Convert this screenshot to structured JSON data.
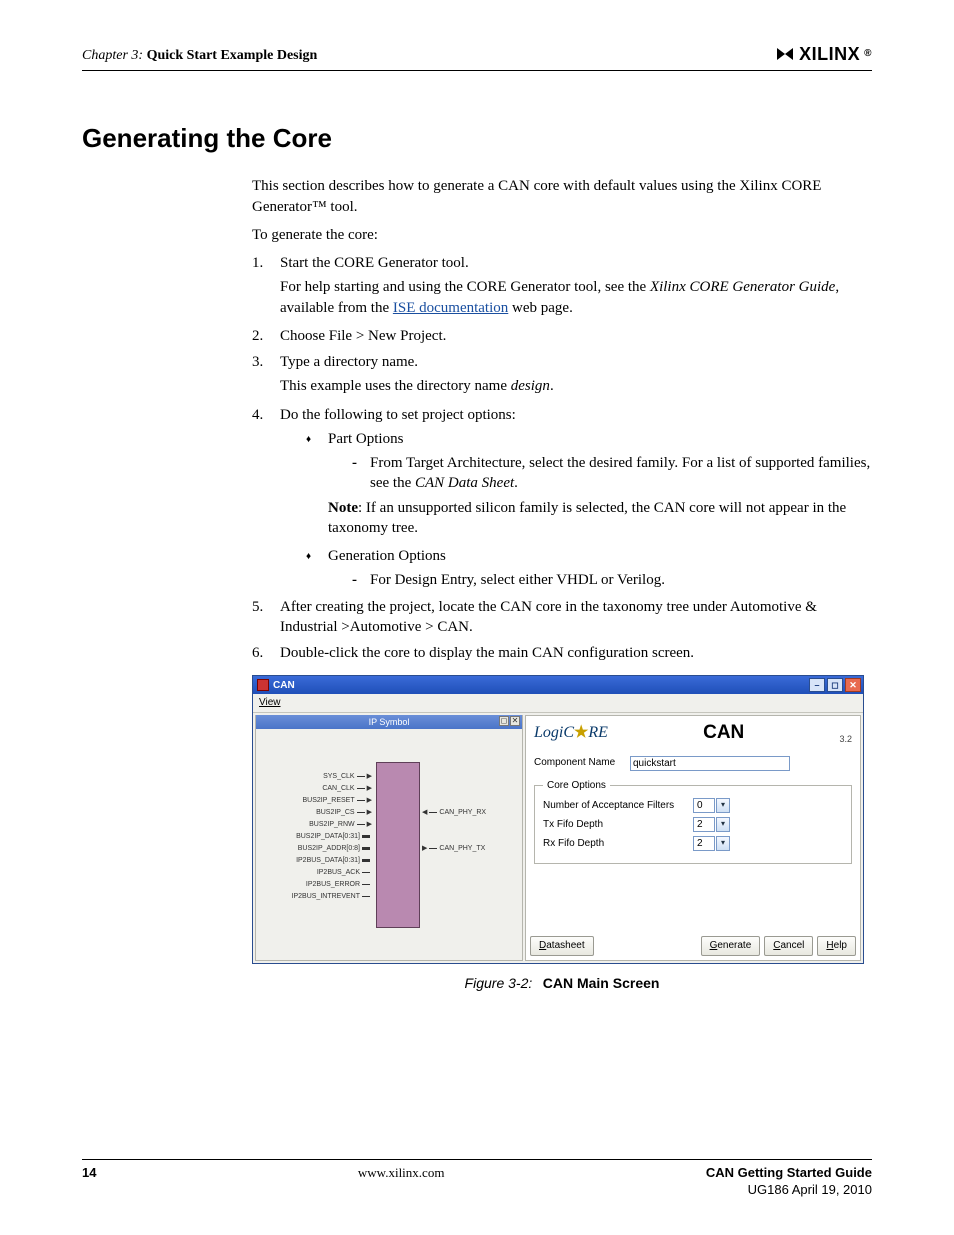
{
  "header": {
    "chapter": "Chapter 3:",
    "chapter_title": "Quick Start Example Design",
    "brand": "XILINX",
    "brand_symbol": "Σ"
  },
  "section_title": "Generating the Core",
  "intro": "This section describes how to generate a CAN core with default values using the Xilinx CORE Generator™ tool.",
  "lead": "To generate the core:",
  "steps": {
    "s1": "Start the CORE Generator tool.",
    "s1_sub_a": "For help starting and using the CORE Generator tool, see the ",
    "s1_sub_b": "Xilinx CORE Generator Guide",
    "s1_sub_c": ", available from the ",
    "s1_link": "ISE documentation",
    "s1_sub_d": " web page.",
    "s2": "Choose File > New Project.",
    "s3": "Type a directory name.",
    "s3_sub_a": "This example uses the directory name ",
    "s3_sub_b": "design",
    "s3_sub_c": ".",
    "s4": "Do the following to set project options:",
    "s4_opt1": "Part Options",
    "s4_opt1_dash_a": "From Target Architecture, select the desired family. For a list of supported families, see the ",
    "s4_opt1_dash_b": "CAN Data Sheet",
    "s4_opt1_dash_c": ".",
    "s4_note_b": "Note",
    "s4_note": ": If an unsupported silicon family is selected, the CAN core will not appear in the taxonomy tree.",
    "s4_opt2": "Generation Options",
    "s4_opt2_dash": "For Design Entry, select either VHDL or Verilog.",
    "s5": "After creating the project, locate the CAN core in the taxonomy tree under Automotive & Industrial >Automotive > CAN.",
    "s6": "Double-click the core to display the main CAN configuration screen."
  },
  "win": {
    "title": "CAN",
    "menu_view": "View",
    "ips_title": "IP Symbol",
    "pins_left": [
      "SYS_CLK",
      "CAN_CLK",
      "BUS2IP_RESET",
      "BUS2IP_CS",
      "BUS2IP_RNW",
      "BUS2IP_DATA[0:31]",
      "BUS2IP_ADDR[0:8]",
      "IP2BUS_DATA[0:31]",
      "IP2BUS_ACK",
      "IP2BUS_ERROR",
      "IP2BUS_INTREVENT"
    ],
    "pins_right": [
      "CAN_PHY_RX",
      "CAN_PHY_TX"
    ],
    "right": {
      "logicore": "LogiC",
      "logicore2": "RE",
      "title": "CAN",
      "version": "3.2",
      "compname_label": "Component Name",
      "compname_value": "quickstart",
      "fieldset": "Core Options",
      "row1_label": "Number of Acceptance Filters",
      "row1_val": "0",
      "row2_label": "Tx Fifo Depth",
      "row2_val": "2",
      "row3_label": "Rx Fifo Depth",
      "row3_val": "2",
      "btn_datasheet": "Datasheet",
      "btn_generate": "Generate",
      "btn_cancel": "Cancel",
      "btn_help": "Help"
    }
  },
  "figure": {
    "num": "Figure 3-2:",
    "title": "CAN Main Screen"
  },
  "footer": {
    "page": "14",
    "url": "www.xilinx.com",
    "doc_title": "CAN Getting Started Guide",
    "doc_sub": "UG186 April 19, 2010"
  }
}
